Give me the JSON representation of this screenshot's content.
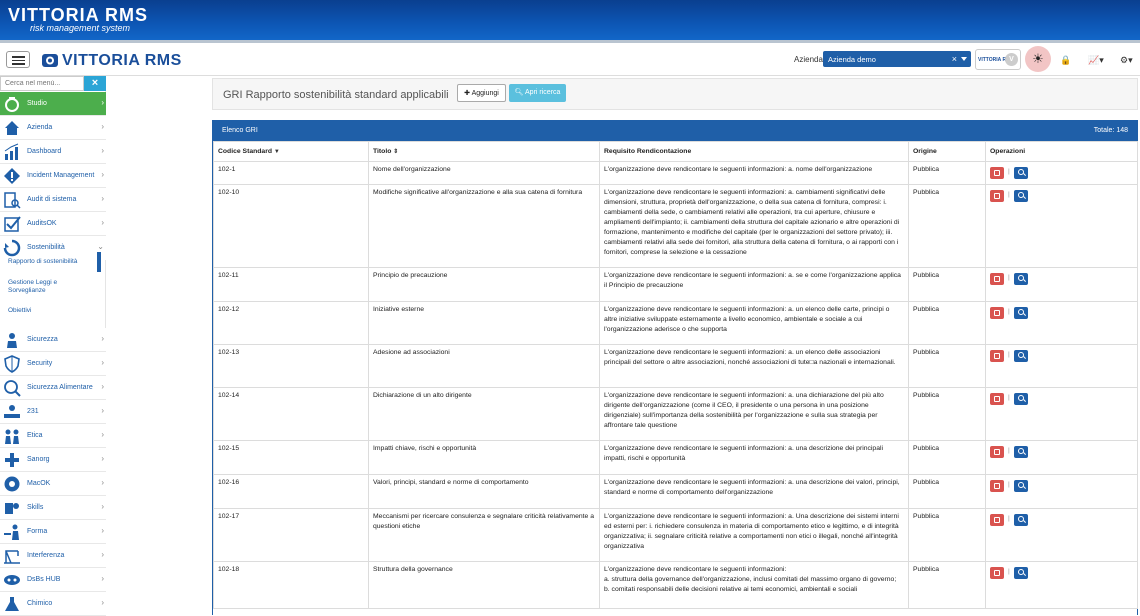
{
  "banner": {
    "logo_title": "VITTORIA RMS",
    "logo_subtitle": "risk management system"
  },
  "topbar": {
    "logo_text": "VITTORIA RMS",
    "azienda_label": "Azienda:",
    "azienda_value": "Azienda demo",
    "clear_symbol": "×",
    "vittoria_small_logo": "VITTORIA RMS",
    "v_badge": "V",
    "sun_symbol": "☀",
    "lock_symbol": "🔒",
    "chart_symbol": "📈▾",
    "gear_symbol": "⚙▾"
  },
  "sidebar": {
    "search_placeholder": "Cerca nel menù...",
    "search_clear": "×",
    "items": [
      {
        "label": "Studio",
        "active": true
      },
      {
        "label": "Azienda"
      },
      {
        "label": "Dashboard"
      },
      {
        "label": "Incident Management"
      },
      {
        "label": "Audit di sistema"
      },
      {
        "label": "AuditsOK"
      },
      {
        "label": "Sostenibilità"
      },
      {
        "label": "Sicurezza"
      },
      {
        "label": "Security"
      },
      {
        "label": "Sicurezza Alimentare"
      },
      {
        "label": "231"
      },
      {
        "label": "Etica"
      },
      {
        "label": "Sanorg"
      },
      {
        "label": "MacOK"
      },
      {
        "label": "Skills"
      },
      {
        "label": "Forma"
      },
      {
        "label": "Interferenza"
      },
      {
        "label": "DsBs HUB"
      },
      {
        "label": "Chimico"
      }
    ],
    "subitems": [
      "Rapporto di sostenibilità",
      "Gestione Leggi e Sorveglianze",
      "Obiettivi"
    ]
  },
  "header": {
    "title": "GRI Rapporto sostenibilità standard applicabili",
    "add_button": "Aggiungi",
    "search_button": "Apri ricerca"
  },
  "panel": {
    "title": "Elenco GRI",
    "total": "Totale: 148"
  },
  "columns": [
    "Codice Standard",
    "Titolo",
    "Requisito Rendicontazione",
    "Origine",
    "Operazioni"
  ],
  "rows": [
    {
      "code": "102-1",
      "title": "Nome dell'organizzazione",
      "req": "L'organizzazione deve rendicontare le seguenti informazioni: a. nome dell'organizzazione",
      "origin": "Pubblica"
    },
    {
      "code": "102-10",
      "title": "Modifiche significative all'organizzazione e alla sua catena di fornitura",
      "req": "L'organizzazione deve rendicontare le seguenti informazioni: a. cambiamenti significativi delle dimensioni, struttura, proprietà dell'organizzazione, o della sua catena di fornitura, compresi: i. cambiamenti della sede, o cambiamenti relativi alle operazioni, tra cui aperture, chiusure e ampliamenti dell'impianto; ii. cambiamenti della struttura del capitale azionario e altre operazioni di formazione, mantenimento e modifiche del capitale (per le organizzazioni del settore privato); iii. cambiamenti relativi alla sede dei fornitori, alla struttura della catena di fornitura, o ai rapporti con i fornitori, comprese la selezione e la cessazione",
      "origin": "Pubblica"
    },
    {
      "code": "102-11",
      "title": "Principio de precauzione",
      "req": "L'organizzazione deve rendicontare le seguenti informazioni: a. se e come l'organizzazione applica il Principio de precauzione",
      "origin": "Pubblica"
    },
    {
      "code": "102-12",
      "title": "Iniziative esterne",
      "req": "L'organizzazione deve rendicontare le seguenti informazioni: a. un elenco delle carte, principi o altre iniziative sviluppate esternamente a livello economico, ambientale e sociale a cui l'organizzazione aderisce o che supporta",
      "origin": "Pubblica"
    },
    {
      "code": "102-13",
      "title": "Adesione ad associazioni",
      "req": "L'organizzazione deve rendicontare le seguenti informazioni: a. un elenco delle associazioni principali del settore o altre associazioni, nonché associazioni di tute□a nazionali e internazionali.",
      "origin": "Pubblica"
    },
    {
      "code": "102-14",
      "title": "Dichiarazione di un alto dirigente",
      "req": "L'organizzazione deve rendicontare le seguenti informazioni: a. una dichiarazione del più alto dirigente dell'organizzazione (come il CEO, il presidente o una persona in una posizione dirigenziale) sull'importanza della sostenibilità per l'organizzazione e sulla sua strategia per affrontare tale questione",
      "origin": "Pubblica"
    },
    {
      "code": "102-15",
      "title": "Impatti chiave, rischi e opportunità",
      "req": "L'organizzazione deve rendicontare le seguenti informazioni: a. una descrizione dei principali impatti, rischi e opportunità",
      "origin": "Pubblica"
    },
    {
      "code": "102-16",
      "title": "Valori, principi, standard e norme di comportamento",
      "req": "L'organizzazione deve rendicontare le seguenti informazioni: a. una descrizione dei valori, principi, standard e norme di comportamento dell'organizzazione",
      "origin": "Pubblica"
    },
    {
      "code": "102-17",
      "title": "Meccanismi per ricercare consulenza e segnalare criticità relativamente a questioni etiche",
      "req": "L'organizzazione deve rendicontare le seguenti informazioni: a. Una descrizione dei sistemi interni ed esterni per: i. richiedere consulenza in materia di comportamento etico e legittimo, e di integrità organizzativa; ii. segnalare criticità relative a comportamenti non etici o illegali, nonché all'integrità organizzativa",
      "origin": "Pubblica"
    },
    {
      "code": "102-18",
      "title": "Struttura della governance",
      "req": "L'organizzazione deve rendicontare le seguenti informazioni:\na. struttura della governance dell'organizzazione, inclusi comitati del massimo organo di governo;\nb. comitati responsabili delle decisioni relative ai temi economici, ambientali e sociali",
      "origin": "Pubblica"
    }
  ]
}
